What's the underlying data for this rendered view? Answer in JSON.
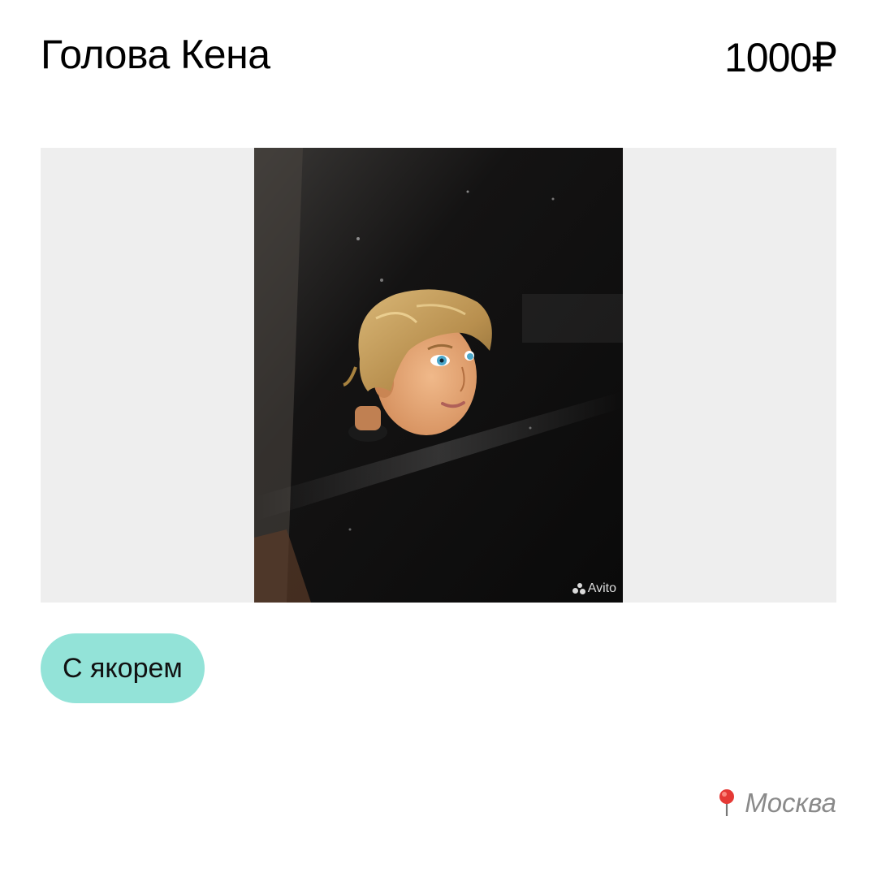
{
  "listing": {
    "title": "Голова Кена",
    "price": "1000₽",
    "tag": "С якорем",
    "location": "Москва"
  },
  "photo": {
    "subject": "doll-head",
    "watermark": "Avito"
  },
  "colors": {
    "tag_background": "#93e3d8",
    "gallery_background": "#eeeeee",
    "location_text": "#8a8a8a",
    "pin_red": "#e53935"
  },
  "icons": {
    "location": "map-pin-icon",
    "watermark": "avito-logo-icon"
  }
}
